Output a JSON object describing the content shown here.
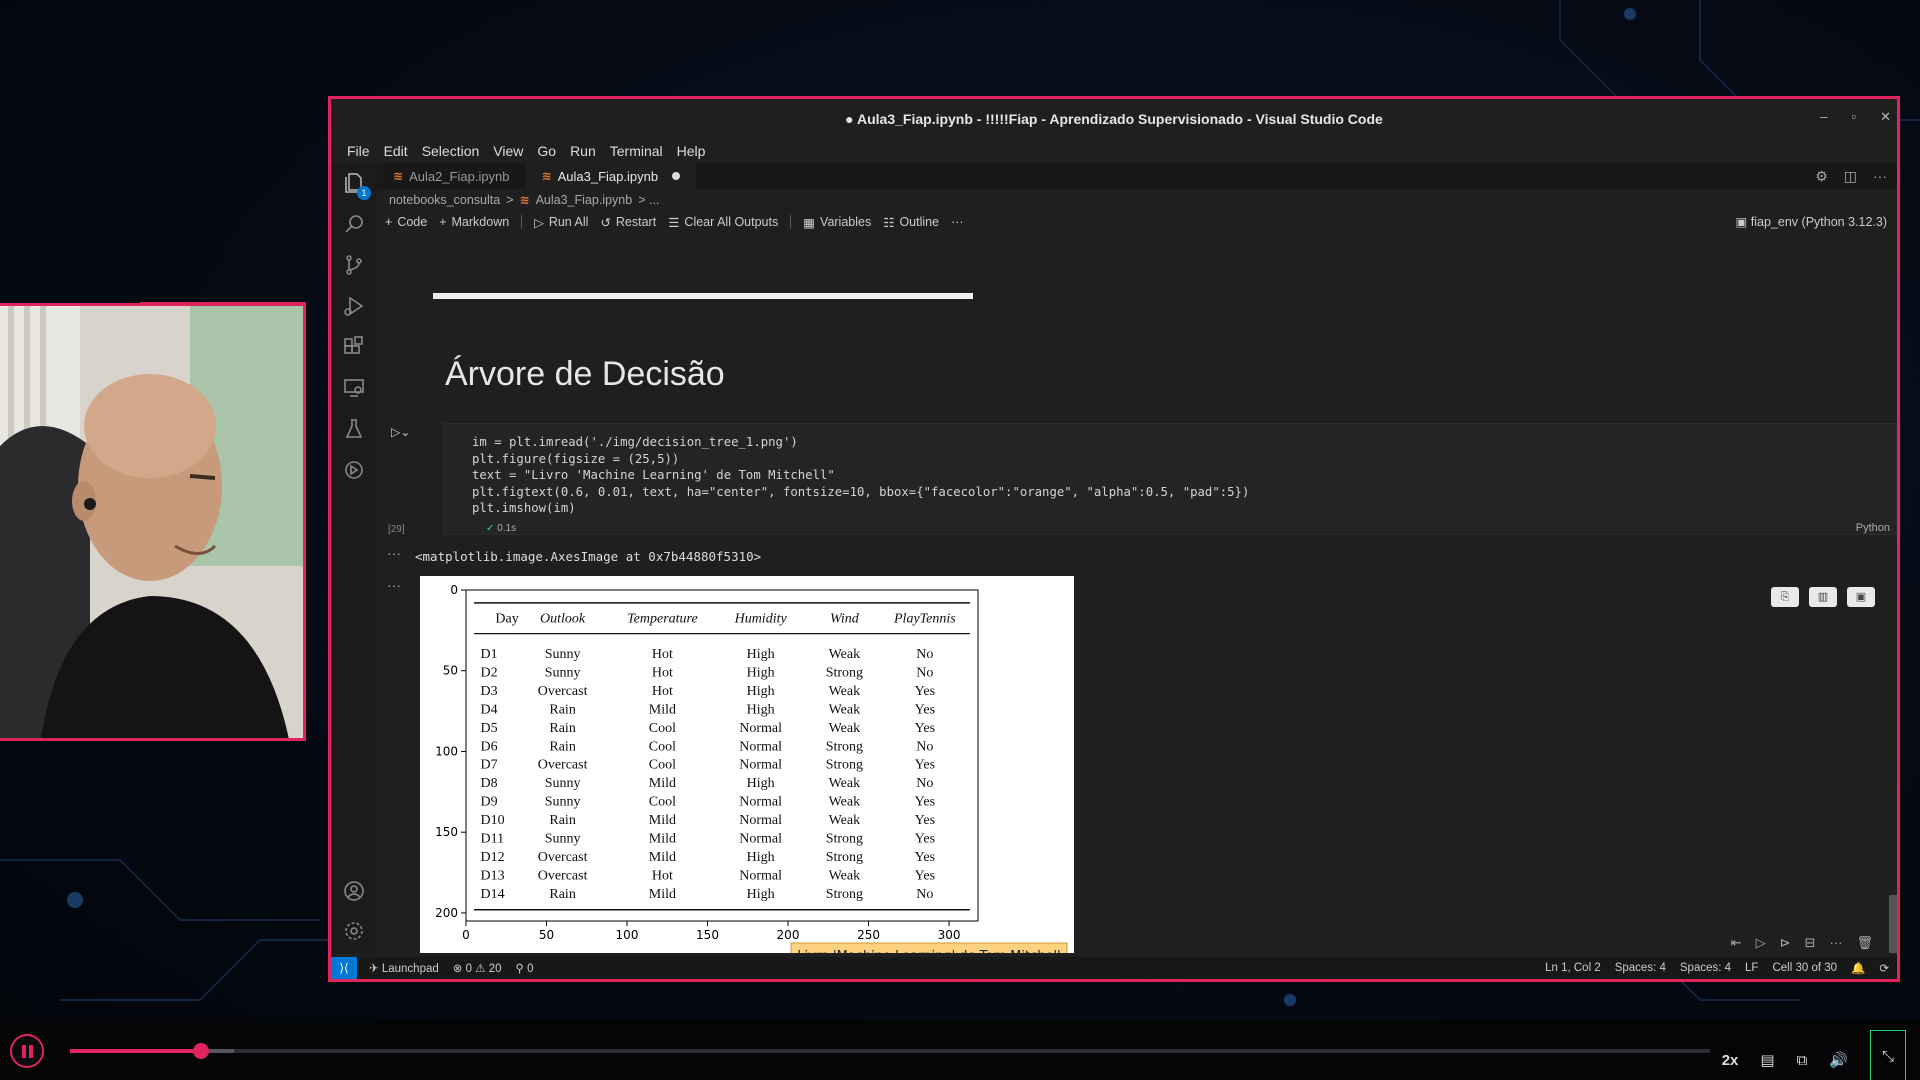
{
  "window": {
    "title": "● Aula3_Fiap.ipynb - !!!!!Fiap - Aprendizado Supervisionado - Visual Studio Code",
    "controls": [
      "–",
      "▫",
      "✕"
    ]
  },
  "menu": [
    "File",
    "Edit",
    "Selection",
    "View",
    "Go",
    "Run",
    "Terminal",
    "Help"
  ],
  "activity_bar": {
    "explorer_badge": "1",
    "icons": [
      "files-icon",
      "search-icon",
      "source-control-icon",
      "run-debug-icon",
      "extensions-icon",
      "remote-explorer-icon",
      "testing-icon",
      "timeline-icon"
    ],
    "bottom_icons": [
      "account-icon",
      "settings-gear-icon"
    ]
  },
  "tabs": [
    {
      "label": "Aula2_Fiap.ipynb",
      "active": false
    },
    {
      "label": "Aula3_Fiap.ipynb",
      "active": true
    }
  ],
  "breadcrumb": {
    "folder": "notebooks_consulta",
    "separator": ">",
    "file": "Aula3_Fiap.ipynb",
    "tail": "> ..."
  },
  "toolbar": {
    "code": "Code",
    "markdown": "Markdown",
    "run_all": "Run All",
    "restart": "Restart",
    "clear_outputs": "Clear All Outputs",
    "variables": "Variables",
    "outline": "Outline",
    "more": "···",
    "kernel": "fiap_env (Python 3.12.3)"
  },
  "notebook": {
    "heading": "Árvore de Decisão",
    "cell": {
      "exec_count": "[29]",
      "exec_time": "0.1s",
      "language": "Python",
      "lines": [
        "im = plt.imread('./img/decision_tree_1.png')",
        "plt.figure(figsize = (25,5))",
        "text = \"Livro 'Machine Learning' de Tom Mitchell\"",
        "plt.figtext(0.6, 0.01, text, ha=\"center\", fontsize=10, bbox={\"facecolor\":\"orange\", \"alpha\":0.5, \"pad\":5})",
        "plt.imshow(im)"
      ]
    },
    "output_text": "<matplotlib.image.AxesImage at 0x7b44880f5310>",
    "output_dots": "···"
  },
  "chart_data": {
    "type": "table",
    "x_ticks": [
      "0",
      "50",
      "100",
      "150",
      "200",
      "250",
      "300"
    ],
    "y_ticks": [
      "0",
      "50",
      "100",
      "150",
      "200"
    ],
    "xlim": [
      0,
      318
    ],
    "ylim": [
      0,
      205
    ],
    "columns": [
      "Day",
      "Outlook",
      "Temperature",
      "Humidity",
      "Wind",
      "PlayTennis"
    ],
    "rows": [
      [
        "D1",
        "Sunny",
        "Hot",
        "High",
        "Weak",
        "No"
      ],
      [
        "D2",
        "Sunny",
        "Hot",
        "High",
        "Strong",
        "No"
      ],
      [
        "D3",
        "Overcast",
        "Hot",
        "High",
        "Weak",
        "Yes"
      ],
      [
        "D4",
        "Rain",
        "Mild",
        "High",
        "Weak",
        "Yes"
      ],
      [
        "D5",
        "Rain",
        "Cool",
        "Normal",
        "Weak",
        "Yes"
      ],
      [
        "D6",
        "Rain",
        "Cool",
        "Normal",
        "Strong",
        "No"
      ],
      [
        "D7",
        "Overcast",
        "Cool",
        "Normal",
        "Strong",
        "Yes"
      ],
      [
        "D8",
        "Sunny",
        "Mild",
        "High",
        "Weak",
        "No"
      ],
      [
        "D9",
        "Sunny",
        "Cool",
        "Normal",
        "Weak",
        "Yes"
      ],
      [
        "D10",
        "Rain",
        "Mild",
        "Normal",
        "Weak",
        "Yes"
      ],
      [
        "D11",
        "Sunny",
        "Mild",
        "Normal",
        "Strong",
        "Yes"
      ],
      [
        "D12",
        "Overcast",
        "Mild",
        "High",
        "Strong",
        "Yes"
      ],
      [
        "D13",
        "Overcast",
        "Hot",
        "Normal",
        "Weak",
        "Yes"
      ],
      [
        "D14",
        "Rain",
        "Mild",
        "High",
        "Strong",
        "No"
      ]
    ],
    "caption": "Livro 'Machine Learning' de Tom Mitchell",
    "caption_color": "#ffd280"
  },
  "statusbar": {
    "launchpad": "Launchpad",
    "errors": "⊗ 0",
    "warnings": "⚠ 20",
    "ports": "⚲ 0",
    "position": "Ln 1, Col 2",
    "spaces1": "Spaces: 4",
    "spaces2": "Spaces: 4",
    "eol": "LF",
    "cell": "Cell 30 of 30"
  },
  "player": {
    "speed": "2x",
    "progress": 0.08,
    "buffered": 0.1,
    "accent": "#e0245e"
  }
}
